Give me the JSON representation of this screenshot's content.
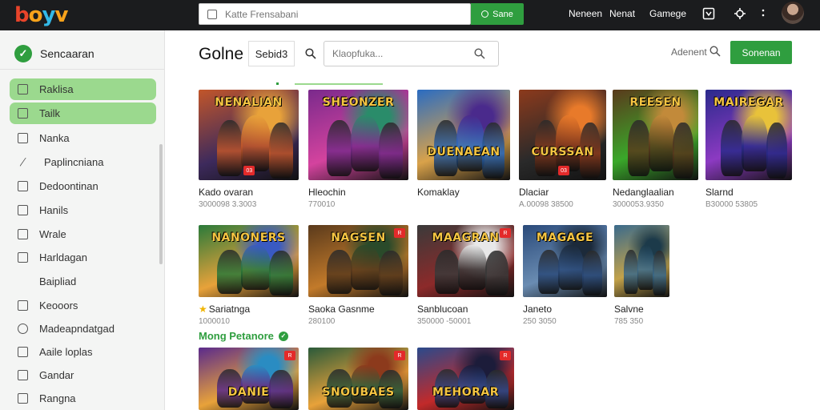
{
  "topbar": {
    "logo": [
      "b",
      "o",
      "y",
      "v"
    ],
    "search_placeholder": "Katte Frensabani",
    "search_button": "Sane",
    "nav": [
      "Neneen",
      "Nenat",
      "Gamege"
    ]
  },
  "sidebar": {
    "brand": "Sencaaran",
    "items": [
      {
        "label": "Raklisa",
        "icon": "checkbox-icon",
        "active": true
      },
      {
        "label": "Tailk",
        "icon": "square-icon",
        "active": true
      },
      {
        "label": "Nanka",
        "icon": "square-icon",
        "active": false
      },
      {
        "label": "Paplincniana",
        "icon": "pencil-icon",
        "active": false
      },
      {
        "label": "Dedoontinan",
        "icon": "checkbox-icon",
        "active": false
      },
      {
        "label": "Hanils",
        "icon": "square-icon",
        "active": false
      },
      {
        "label": "Wrale",
        "icon": "checkbox-icon",
        "active": false
      },
      {
        "label": "Harldagan",
        "icon": "checkbox-icon",
        "active": false
      },
      {
        "label": "Baipliad",
        "icon": "none",
        "active": false
      },
      {
        "label": "Keooors",
        "icon": "square-icon",
        "active": false
      },
      {
        "label": "Madeapndatgad",
        "icon": "circle-icon",
        "active": false
      },
      {
        "label": "Aaile loplas",
        "icon": "square-icon",
        "active": false
      },
      {
        "label": "Gandar",
        "icon": "square-icon",
        "active": false
      },
      {
        "label": "Rangna",
        "icon": "square-icon",
        "active": false
      }
    ]
  },
  "main": {
    "title": "Golne",
    "title_tab": "Sebid3",
    "search_placeholder": "Klaopfuka...",
    "advanced_label": "Adenent",
    "action_button": "Sonenan",
    "section_title": "Mong Petanore"
  },
  "games": [
    {
      "name": "Kado ovaran",
      "meta": "3000098 3.3003",
      "art": "NENALIAN",
      "colors": [
        "#c2562a",
        "#3d2a5c",
        "#e8a23a"
      ],
      "badge": "03",
      "star": false
    },
    {
      "name": "Hleochin",
      "meta": "770010",
      "art": "SHEONZER",
      "colors": [
        "#7a2a8c",
        "#d4439e",
        "#2a8c6a"
      ],
      "badge": "",
      "star": false
    },
    {
      "name": "Komaklay",
      "meta": "",
      "art": "DUENAEAN",
      "colors": [
        "#2a6cc2",
        "#d9a24a",
        "#4a2a8c"
      ],
      "badge": "",
      "star": false
    },
    {
      "name": "Dlaciar",
      "meta": "A.00098 38500",
      "art": "CURSSAN",
      "colors": [
        "#8c3a1c",
        "#2a2a2a",
        "#e87a2a"
      ],
      "badge": "03",
      "star": false
    },
    {
      "name": "Nedanglaalian",
      "meta": "3000053.9350",
      "art": "REESEN",
      "colors": [
        "#5a3a1c",
        "#3aa82a",
        "#c28a3a"
      ],
      "badge": "",
      "star": false
    },
    {
      "name": "Slarnd",
      "meta": "B30000 53805",
      "art": "MAIREGAR",
      "colors": [
        "#2a2a8c",
        "#8c3ac2",
        "#e8c23a"
      ],
      "badge": "",
      "star": false
    },
    {
      "name": "Sariatnga",
      "meta": "1000010",
      "art": "NANONERS",
      "colors": [
        "#2a7a3a",
        "#e8a23a",
        "#3a5ac2"
      ],
      "badge": "",
      "star": true
    },
    {
      "name": "Saoka Gasnme",
      "meta": "280100",
      "art": "NAGSEN",
      "colors": [
        "#5a3a1c",
        "#c27a2a",
        "#2a4a2a"
      ],
      "badge": "R",
      "star": false
    },
    {
      "name": "Sanblucoan",
      "meta": "350000 -50001",
      "art": "MAAGRAN",
      "colors": [
        "#3a3a3a",
        "#8c2a2a",
        "#e8e8e8"
      ],
      "badge": "R",
      "star": false
    },
    {
      "name": "Janeto",
      "meta": "250 3050",
      "art": "MAGAGE",
      "colors": [
        "#2a4a7a",
        "#6a8cb2",
        "#1c2a3a"
      ],
      "badge": "",
      "star": false
    },
    {
      "name": "Salvne",
      "meta": "785 350",
      "art": "",
      "colors": [
        "#3a6a8c",
        "#c2a24a",
        "#1c3a4a"
      ],
      "badge": "",
      "star": false
    },
    {
      "name": "",
      "meta": "",
      "art": "DANIE",
      "colors": [
        "#5a2a8c",
        "#e8a23a",
        "#2a8cc2"
      ],
      "badge": "R",
      "star": false
    },
    {
      "name": "",
      "meta": "",
      "art": "SNOUBAES",
      "colors": [
        "#2a5a3a",
        "#e8a23a",
        "#8c3a1c"
      ],
      "badge": "R",
      "star": false
    },
    {
      "name": "",
      "meta": "",
      "art": "MEHORAR",
      "colors": [
        "#2a4a8c",
        "#c22a2a",
        "#1c1c3a"
      ],
      "badge": "R",
      "star": false
    }
  ]
}
